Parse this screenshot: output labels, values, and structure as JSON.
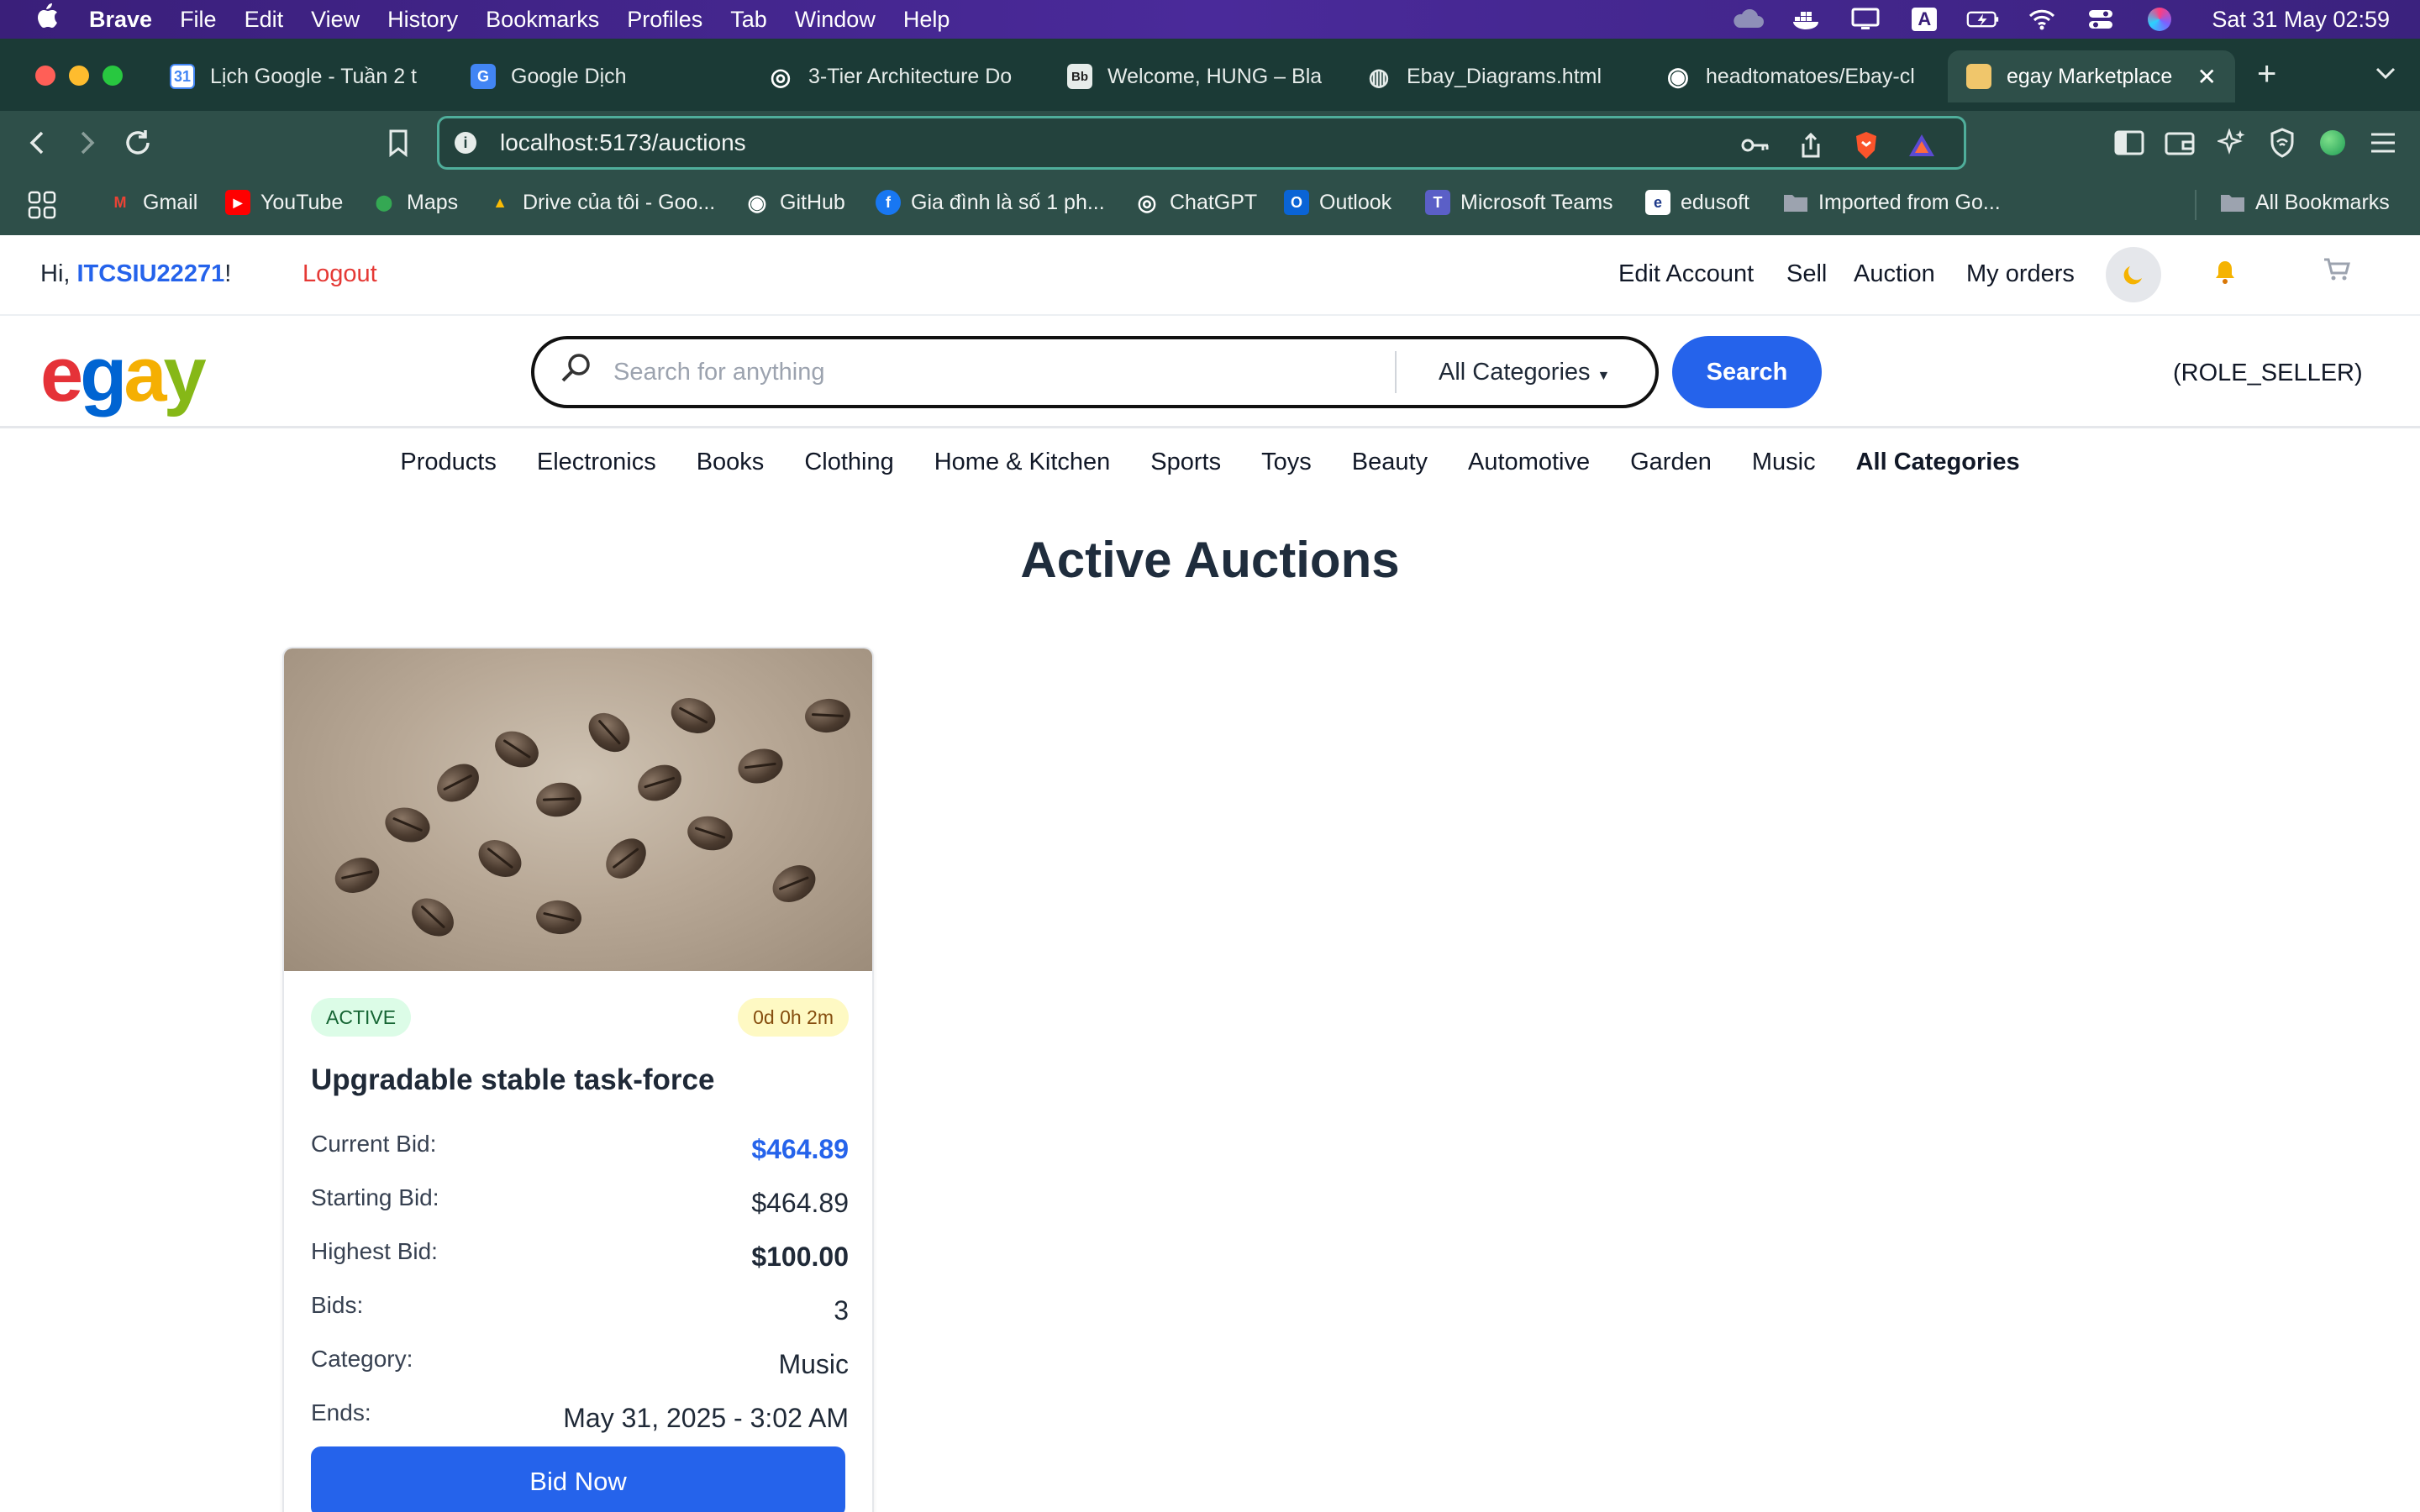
{
  "menubar": {
    "apple": "",
    "app_name": "Brave",
    "items": [
      "File",
      "Edit",
      "View",
      "History",
      "Bookmarks",
      "Profiles",
      "Tab",
      "Window",
      "Help"
    ],
    "clock": "Sat 31 May  02:59",
    "input_badge": "A"
  },
  "tabs": [
    {
      "label": "Lịch Google - Tuần 2 t",
      "fav": "31",
      "fav_color": "#4285f4"
    },
    {
      "label": "Google Dịch",
      "fav": "G",
      "fav_color": "#4285f4"
    },
    {
      "label": "3-Tier Architecture Do",
      "fav": "◎",
      "fav_color": "#444444"
    },
    {
      "label": "Welcome, HUNG – Bla",
      "fav": "Bb",
      "fav_color": "#222222"
    },
    {
      "label": "Ebay_Diagrams.html",
      "fav": "◍",
      "fav_color": "#555555"
    },
    {
      "label": "headtomatoes/Ebay-cl",
      "fav": "◉",
      "fav_color": "#111111"
    },
    {
      "label": "egay Marketplace",
      "fav": "",
      "fav_color": "#f0c66b",
      "close": "✕"
    }
  ],
  "address": {
    "url": "localhost:5173/auctions"
  },
  "bookmarks": [
    {
      "label": "Gmail",
      "ico": "M",
      "color": "#ea4335"
    },
    {
      "label": "YouTube",
      "ico": "▶",
      "color": "#ff0000"
    },
    {
      "label": "Maps",
      "ico": "⬤",
      "color": "#34a853"
    },
    {
      "label": "Drive của tôi - Goo...",
      "ico": "▲",
      "color": "#fbbc04"
    },
    {
      "label": "GitHub",
      "ico": "◉",
      "color": "#24292e"
    },
    {
      "label": "Gia đình là số 1 ph...",
      "ico": "f",
      "color": "#1877f2"
    },
    {
      "label": "ChatGPT",
      "ico": "◎",
      "color": "#10a37f"
    },
    {
      "label": "Outlook",
      "ico": "O",
      "color": "#0a64d6"
    },
    {
      "label": "Microsoft Teams",
      "ico": "T",
      "color": "#5b5fc7"
    },
    {
      "label": "edusoft",
      "ico": "e",
      "color": "#1e3a8a"
    },
    {
      "label": "Imported from Go...",
      "ico": "",
      "color": "#9ca3af"
    },
    {
      "label": "All Bookmarks",
      "ico": "",
      "color": "#9ca3af"
    }
  ],
  "userbar": {
    "greeting_prefix": "Hi, ",
    "username": "ITCSIU22271",
    "greeting_suffix": "!",
    "logout": "Logout",
    "links": [
      "Edit Account",
      "Sell",
      "Auction",
      "My orders"
    ]
  },
  "header": {
    "logo_letters": [
      {
        "ch": "e",
        "color": "#e53238"
      },
      {
        "ch": "g",
        "color": "#0064d2"
      },
      {
        "ch": "a",
        "color": "#f5af02"
      },
      {
        "ch": "y",
        "color": "#86b817"
      }
    ],
    "search_placeholder": "Search for anything",
    "category_select": "All Categories",
    "search_button": "Search",
    "role": "(ROLE_SELLER)"
  },
  "categories": [
    "Products",
    "Electronics",
    "Books",
    "Clothing",
    "Home & Kitchen",
    "Sports",
    "Toys",
    "Beauty",
    "Automotive",
    "Garden",
    "Music",
    "All Categories"
  ],
  "main": {
    "title": "Active Auctions"
  },
  "auction": {
    "status": "ACTIVE",
    "time_left": "0d 0h 2m",
    "title": "Upgradable stable task-force",
    "rows": [
      {
        "label": "Current Bid:",
        "value": "$464.89"
      },
      {
        "label": "Starting Bid:",
        "value": "$464.89"
      },
      {
        "label": "Highest Bid:",
        "value": "$100.00"
      },
      {
        "label": "Bids:",
        "value": "3"
      },
      {
        "label": "Category:",
        "value": "Music"
      },
      {
        "label": "Ends:",
        "value": "May 31, 2025 - 3:02 AM"
      }
    ],
    "bid_button": "Bid Now"
  },
  "colors": {
    "accent": "#2563eb",
    "logout": "#e53935",
    "tab_bar": "#1b3a36",
    "toolbar": "#2e4f49"
  }
}
